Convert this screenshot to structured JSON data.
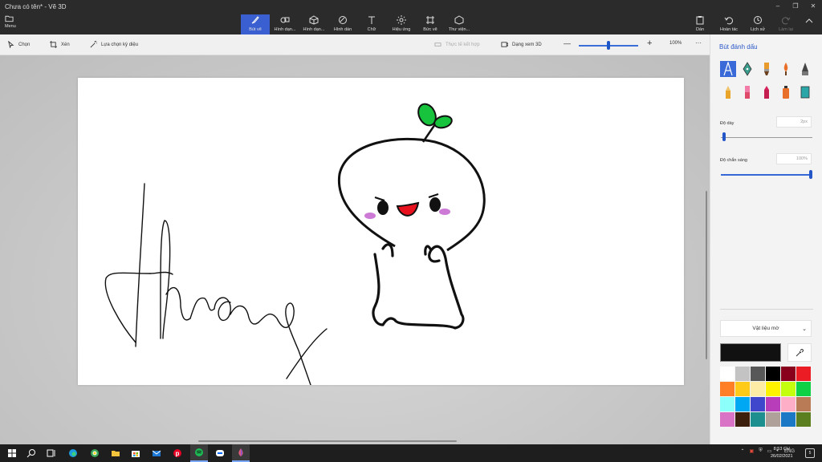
{
  "window": {
    "title": "Chưa có tên* - Vẽ 3D",
    "minimize": "–",
    "restore": "❐",
    "close": "✕"
  },
  "ribbon": {
    "menu_label": "Menu",
    "tools": [
      {
        "label": "Bút vẽ",
        "icon": "brush-icon",
        "active": true
      },
      {
        "label": "Hình dạn...",
        "icon": "shapes-2d-icon",
        "active": false
      },
      {
        "label": "Hình dạn...",
        "icon": "shapes-3d-icon",
        "active": false
      },
      {
        "label": "Hình dán",
        "icon": "stickers-icon",
        "active": false
      },
      {
        "label": "Chữ",
        "icon": "text-icon",
        "active": false
      },
      {
        "label": "Hiệu ứng",
        "icon": "effects-icon",
        "active": false
      },
      {
        "label": "Bức vẽ",
        "icon": "canvas-icon",
        "active": false
      },
      {
        "label": "Thư viện...",
        "icon": "library-icon",
        "active": false
      }
    ],
    "right": [
      {
        "label": "Dán",
        "icon": "paste-icon"
      },
      {
        "label": "Hoàn tác",
        "icon": "undo-icon"
      },
      {
        "label": "Lịch sử",
        "icon": "history-icon"
      },
      {
        "label": "Làm lại",
        "icon": "redo-icon"
      }
    ]
  },
  "toolbar": {
    "select": "Chọn",
    "crop": "Xén",
    "magic_select": "Lựa chọn kỳ diệu",
    "mixed_reality": "Thực tế kết hợp",
    "view_3d": "Dạng xem 3D",
    "zoom_minus": "—",
    "zoom_plus": "+",
    "zoom": "100%",
    "more": "···",
    "zoom_level": 0.5
  },
  "panel": {
    "title": "Bút đánh dấu",
    "brushes": [
      "marker-icon",
      "calligraphy-pen-icon",
      "oil-brush-icon",
      "watercolor-icon",
      "pixel-pen-icon",
      "pencil-icon",
      "eraser-icon",
      "crayon-icon",
      "spraycan-icon",
      "fill-icon"
    ],
    "thickness_label": "Độ dày",
    "thickness_value": "2px",
    "thickness_level": 0.02,
    "opacity_label": "Độ chắn sáng",
    "opacity_value": "100%",
    "opacity_level": 1.0,
    "material": "Vật liệu mờ",
    "palette": [
      "#ffffff",
      "#c3c3c3",
      "#585858",
      "#000000",
      "#88001b",
      "#ec1c24",
      "#ff7f27",
      "#ffca18",
      "#fdeca6",
      "#fff200",
      "#c4ff0e",
      "#0ed145",
      "#8cfffb",
      "#00a8f3",
      "#3f48cc",
      "#b83dba",
      "#ffaec8",
      "#b97a56",
      "#d873c6",
      "#3d1f0e",
      "#1e8f8f",
      "#b0a09a",
      "#1b78c4",
      "#5b7f1e"
    ],
    "current_color": "#111111"
  },
  "taskbar": {
    "apps": [
      "windows-start-icon",
      "search-icon",
      "task-view-icon",
      "edge-icon",
      "chrome-icon",
      "file-explorer-icon",
      "store-icon",
      "mail-icon",
      "pinterest-icon",
      "spotify-icon",
      "zalo-icon",
      "paint3d-icon"
    ],
    "lang": "ENG",
    "time": "8:53 CH",
    "date": "26/02/2021",
    "notifications": "5"
  }
}
